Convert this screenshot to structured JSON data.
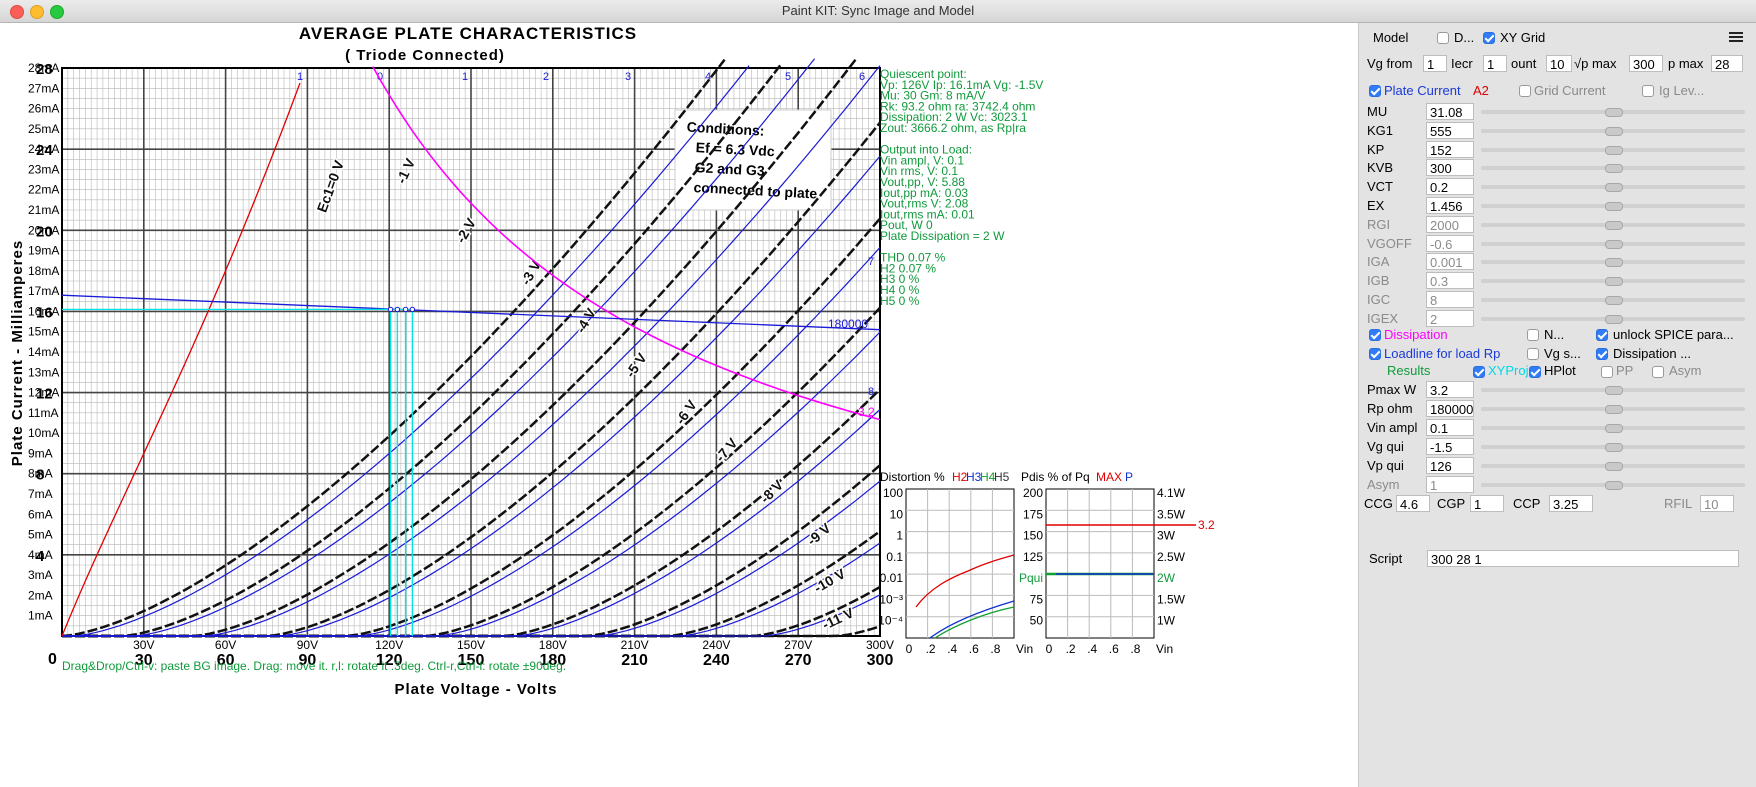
{
  "window": {
    "title": "Paint KIT: Sync Image and Model"
  },
  "plot": {
    "header_title": "AVERAGE PLATE CHARACTERISTICS",
    "header_subtitle": "( Triode Connected)",
    "y_axis_label": "Plate Current - Milliamperes",
    "x_axis_label": "Plate Voltage - Volts",
    "conditions": [
      "Conditions:",
      "Ef = 6.3 Vdc",
      "G2 and G3",
      "connected to plate"
    ],
    "origin_label": "0",
    "help_text": "Drag&Drop/Ctrl-v: paste BG image. Drag: move it. r,l: rotate it .3deg. Ctrl-r,Ctrl-l: rotate ±90deg.",
    "ma_ticks": [
      "28mA",
      "27mA",
      "26mA",
      "25mA",
      "24mA",
      "23mA",
      "22mA",
      "21mA",
      "20mA",
      "19mA",
      "18mA",
      "17mA",
      "16mA",
      "15mA",
      "14mA",
      "13mA",
      "12mA",
      "11mA",
      "10mA",
      "9mA",
      "8mA",
      "7mA",
      "6mA",
      "5mA",
      "4mA",
      "3mA",
      "2mA",
      "1mA"
    ],
    "scan_y_ticks": [
      "28",
      "24",
      "20",
      "16",
      "12",
      "8",
      "4"
    ],
    "v_ticks": [
      "30V",
      "60V",
      "90V",
      "120V",
      "150V",
      "180V",
      "210V",
      "240V",
      "270V",
      "300V"
    ],
    "scan_x_ticks": [
      "30",
      "60",
      "90",
      "120",
      "150",
      "180",
      "210",
      "240",
      "270",
      "300"
    ],
    "curve_labels": [
      "1",
      "0",
      "1",
      "2",
      "3",
      "4",
      "5",
      "6",
      "7",
      "8"
    ],
    "scan_curve_labels": [
      "Ec1=0 V",
      "-1 V",
      "-2 V",
      "-3 V",
      "-4 V",
      "-5 V",
      "-6 V",
      "-7 V",
      "-8 V",
      "-9 V",
      "-10 V",
      "-11 V"
    ],
    "load_line_label": "180000",
    "dissipation_label": "3.2",
    "readout": [
      "Quiescent point:",
      "Vp: 126V  Ip: 16.1mA  Vg: -1.5V",
      "Mu: 30 Gm: 8 mA/V",
      "Rk: 93.2 ohm ra: 3742.4 ohm",
      "Dissipation: 2 W Vc: 3023.1",
      "Zout: 3666.2 ohm, as Rp|ra",
      "",
      "Output into Load:",
      "Vin ampl, V: 0.1",
      "Vin rms,  V: 0.1",
      "Vout,pp,  V: 5.88",
      "Iout,pp   mA: 0.03",
      "Vout,rms   V: 2.08",
      "Iout,rms  mA: 0.01",
      "Pout, W      0",
      "Plate Dissipation = 2 W",
      "",
      "THD 0.07 %",
      "   H2 0.07 %",
      "   H3 0 %",
      "   H4 0 %",
      "   H5 0 %"
    ],
    "distortion": {
      "title": "Distortion %",
      "h_labels": [
        "H2",
        "H3",
        "H4",
        "H5"
      ],
      "h_colors": [
        "#e00000",
        "#1030d0",
        "#10a030",
        "#333333"
      ],
      "y_ticks": [
        "100",
        "10",
        "1",
        "0.1",
        "0.01",
        "10⁻³",
        "10⁻⁴"
      ],
      "x_ticks": [
        "0",
        ".2",
        ".4",
        ".6",
        ".8"
      ],
      "x_unit": "Vin"
    },
    "pdis": {
      "title": "Pdis % of Pq",
      "max_label": "MAX",
      "p_label": "P",
      "y_ticks": [
        "200",
        "175",
        "150",
        "125",
        "Pqui",
        "75",
        "50"
      ],
      "right_ticks": [
        "4.1W",
        "3.5W",
        "3W",
        "2.5W",
        "2W",
        "1.5W",
        "1W"
      ],
      "x_ticks": [
        "0",
        ".2",
        ".4",
        ".6",
        ".8"
      ],
      "x_unit": "Vin",
      "max_value_label": "3.2"
    }
  },
  "panel": {
    "model_label": "Model",
    "d_label": "D...",
    "xygrid_label": "XY Grid",
    "vg_from_label": "Vg from",
    "vg_from": "1",
    "incr_label": "Iecr",
    "incr": "1",
    "count_label": "ount",
    "count": "10",
    "vpmax_label": "√p max",
    "vpmax": "300",
    "pmax_label": "p max",
    "pmax": "28",
    "plate_current_label": "Plate Current",
    "a2_label": "A2",
    "grid_current_label": "Grid Current",
    "ig_label": "Ig Lev...",
    "params": [
      {
        "name": "MU",
        "value": "31.08",
        "enabled": true
      },
      {
        "name": "KG1",
        "value": "555",
        "enabled": true
      },
      {
        "name": "KP",
        "value": "152",
        "enabled": true
      },
      {
        "name": "KVB",
        "value": "300",
        "enabled": true
      },
      {
        "name": "VCT",
        "value": "0.2",
        "enabled": true
      },
      {
        "name": "EX",
        "value": "1.456",
        "enabled": true
      },
      {
        "name": "RGI",
        "value": "2000",
        "enabled": false
      },
      {
        "name": "VGOFF",
        "value": "-0.6",
        "enabled": false
      },
      {
        "name": "IGA",
        "value": "0.001",
        "enabled": false
      },
      {
        "name": "IGB",
        "value": "0.3",
        "enabled": false
      },
      {
        "name": "IGC",
        "value": "8",
        "enabled": false
      },
      {
        "name": "IGEX",
        "value": "2",
        "enabled": false
      }
    ],
    "dissipation_label": "Dissipation",
    "n_label": "N...",
    "unlock_label": "unlock SPICE para...",
    "loadline_label": "Loadline for load Rp",
    "vgs_label": "Vg s...",
    "dissipation2_label": "Dissipation ...",
    "results_label": "Results",
    "xyproj_label": "XYProj",
    "hplot_label": "HPlot",
    "pp_label": "PP",
    "asym_label": "Asym",
    "results": [
      {
        "name": "Pmax W",
        "value": "3.2",
        "enabled": true
      },
      {
        "name": "Rp ohm",
        "value": "180000",
        "enabled": true
      },
      {
        "name": "Vin ampl",
        "value": "0.1",
        "enabled": true
      },
      {
        "name": "Vg qui",
        "value": "-1.5",
        "enabled": true
      },
      {
        "name": "Vp qui",
        "value": "126",
        "enabled": true
      },
      {
        "name": "Asym",
        "value": "1",
        "enabled": false
      }
    ],
    "ccg_label": "CCG",
    "ccg": "4.6",
    "cgp_label": "CGP",
    "cgp": "1",
    "ccp_label": "CCP",
    "ccp": "3.25",
    "rfil_label": "RFIL",
    "rfil": "10",
    "script_label": "Script",
    "script": "300 28 1"
  },
  "colors": {
    "readout": "#109a3c",
    "dissipation": "#ff00ff",
    "model_curve": "#1a1ad8",
    "loadline": "#1a1ad8",
    "cyan": "#00e5e5",
    "red": "#e00000"
  }
}
